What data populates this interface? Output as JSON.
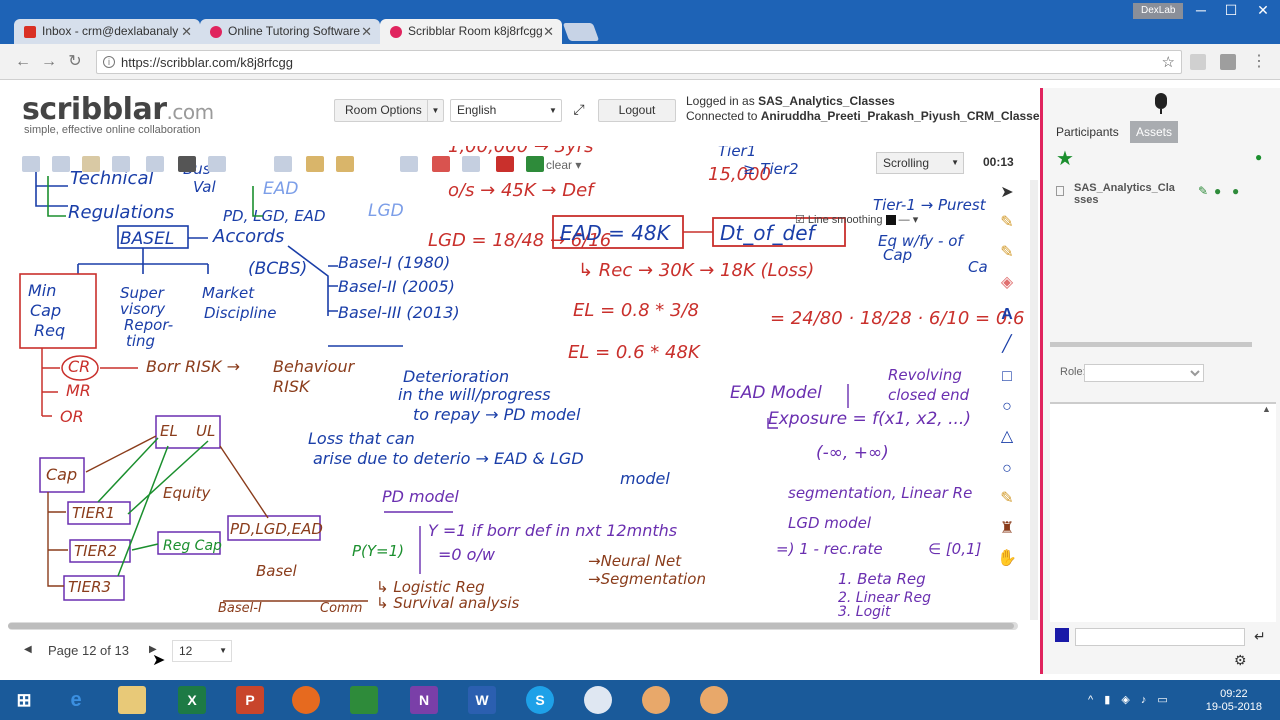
{
  "browser": {
    "tabs": [
      {
        "label": "Inbox - crm@dexlabanaly",
        "fav_color": "#d93025"
      },
      {
        "label": "Online Tutoring Software",
        "fav_color": "#e0245e"
      },
      {
        "label": "Scribblar Room k8j8rfcgg",
        "fav_color": "#e0245e"
      }
    ],
    "window_brand": "DexLab",
    "url": "https://scribblar.com/k8j8rfcgg"
  },
  "app": {
    "logo_main": "scribblar",
    "logo_suffix": ".com",
    "tagline": "simple, effective online collaboration",
    "room_options_label": "Room Options",
    "language_label": "English",
    "logout_label": "Logout",
    "logged_in_prefix": "Logged in as",
    "logged_in_user": "SAS_Analytics_Classes",
    "connected_prefix": "Connected to",
    "connected_users": "Aniruddha_Preeti_Prakash_Piyush_CRM_Classes"
  },
  "whiteboard": {
    "clear_label": "clear",
    "scrolling_label": "Scrolling",
    "timer": "00:13",
    "line_smoothing_label": "Line smoothing",
    "page_label": "Page 12 of 13",
    "page_select": "12"
  },
  "right_panel": {
    "tab_participants": "Participants",
    "tab_assets": "Assets",
    "participant_name": "SAS_Analytics_Cla sses",
    "role_label": "Role:",
    "accent_color": "#e0245e"
  },
  "taskbar": {
    "time": "09:22",
    "date": "19-05-2018"
  }
}
